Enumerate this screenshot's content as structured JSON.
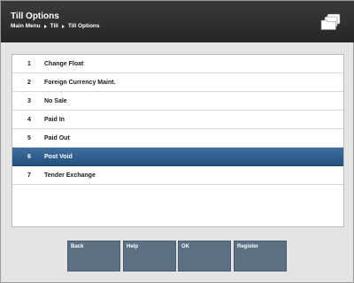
{
  "header": {
    "title": "Till Options",
    "breadcrumb": [
      "Main Menu",
      "Till",
      "Till Options"
    ],
    "icon": "folders-icon"
  },
  "menu": {
    "items": [
      {
        "num": "1",
        "label": "Change Float"
      },
      {
        "num": "2",
        "label": "Foreign Currency Maint."
      },
      {
        "num": "3",
        "label": "No Sale"
      },
      {
        "num": "4",
        "label": "Paid In"
      },
      {
        "num": "5",
        "label": "Paid Out"
      },
      {
        "num": "6",
        "label": "Post Void"
      },
      {
        "num": "7",
        "label": "Tender Exchange"
      }
    ],
    "selected_index": 5
  },
  "buttons": {
    "back": "Back",
    "help": "Help",
    "ok": "OK",
    "register": "Register"
  },
  "colors": {
    "header_bg": "#2e2e2e",
    "selected_row": "#2d5c8c",
    "button_bg": "#5b6f85",
    "background": "#e4e4e4"
  }
}
